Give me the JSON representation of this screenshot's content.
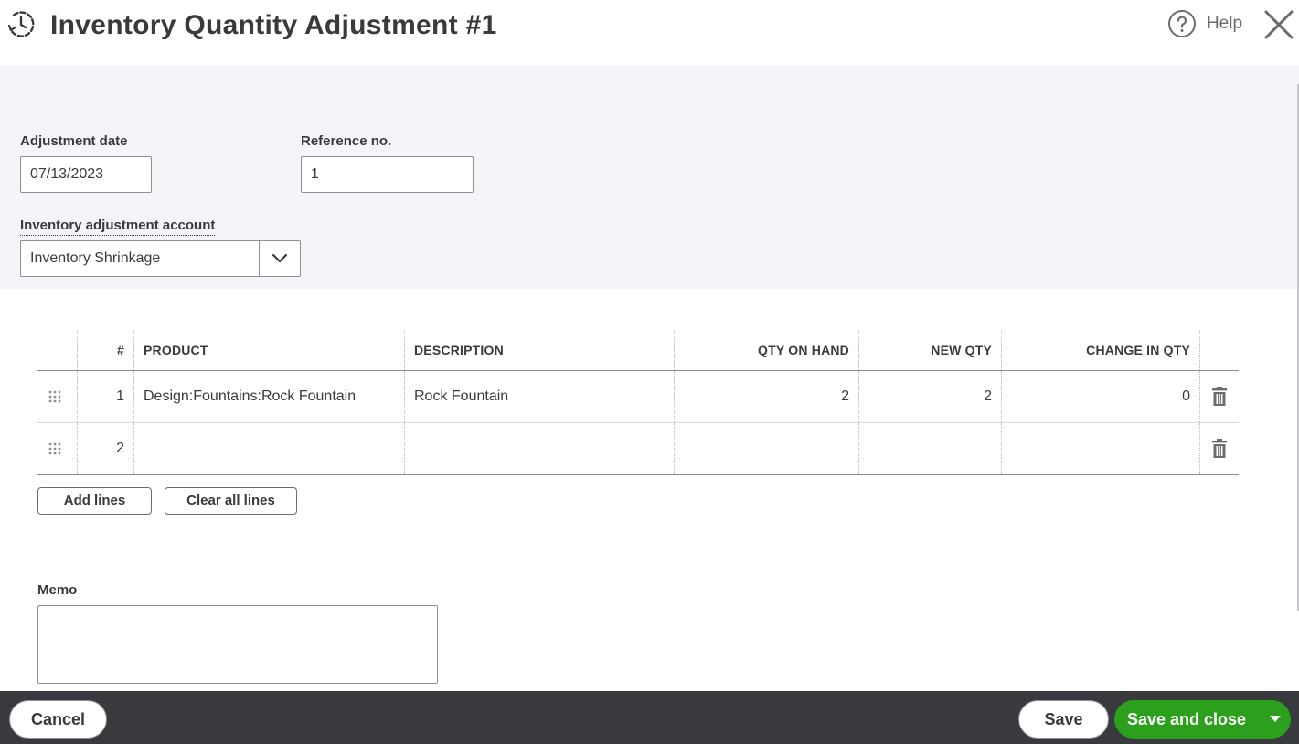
{
  "header": {
    "title": "Inventory Quantity Adjustment #1",
    "help_label": "Help",
    "history_icon": "history-clock-icon",
    "help_icon": "question-circle-icon",
    "close_icon": "close-x-icon"
  },
  "form": {
    "adjustment_date_label": "Adjustment date",
    "adjustment_date_value": "07/13/2023",
    "reference_label": "Reference no.",
    "reference_value": "1",
    "account_label": "Inventory adjustment account",
    "account_value": "Inventory Shrinkage"
  },
  "table": {
    "headers": {
      "num": "#",
      "product": "PRODUCT",
      "description": "DESCRIPTION",
      "qty_on_hand": "QTY ON HAND",
      "new_qty": "NEW QTY",
      "change_in_qty": "CHANGE IN QTY"
    },
    "rows": [
      {
        "num": "1",
        "product": "Design:Fountains:Rock Fountain",
        "description": "Rock Fountain",
        "qty_on_hand": "2",
        "new_qty": "2",
        "change_in_qty": "0"
      },
      {
        "num": "2",
        "product": "",
        "description": "",
        "qty_on_hand": "",
        "new_qty": "",
        "change_in_qty": ""
      }
    ],
    "add_lines_label": "Add lines",
    "clear_all_lines_label": "Clear all lines"
  },
  "memo": {
    "label": "Memo",
    "value": ""
  },
  "footer": {
    "cancel_label": "Cancel",
    "save_label": "Save",
    "save_and_close_label": "Save and close"
  },
  "colors": {
    "primary_green": "#2ca01c",
    "footer_bg": "#393a3d",
    "panel_bg": "#f4f5f8",
    "text": "#393a3d"
  }
}
